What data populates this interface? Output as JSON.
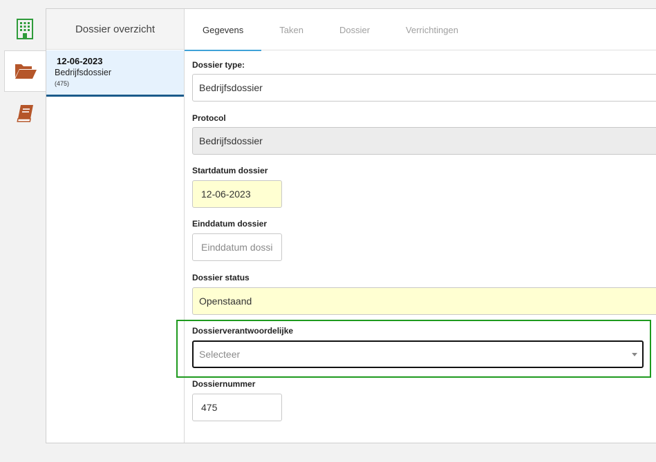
{
  "sidebar": {
    "items": [
      {
        "name": "building-icon",
        "color": "#2e9b3a"
      },
      {
        "name": "open-folder-icon",
        "color": "#b5562a"
      },
      {
        "name": "book-icon",
        "color": "#b5562a"
      }
    ]
  },
  "dossier_list": {
    "header": "Dossier overzicht",
    "entries": [
      {
        "date": "12-06-2023",
        "type": "Bedrijfsdossier",
        "id": "(475)"
      }
    ]
  },
  "tabs": [
    {
      "label": "Gegevens",
      "active": true
    },
    {
      "label": "Taken",
      "active": false
    },
    {
      "label": "Dossier",
      "active": false
    },
    {
      "label": "Verrichtingen",
      "active": false
    }
  ],
  "form": {
    "dossier_type": {
      "label": "Dossier type:",
      "value": "Bedrijfsdossier"
    },
    "protocol": {
      "label": "Protocol",
      "value": "Bedrijfsdossier"
    },
    "startdatum": {
      "label": "Startdatum dossier",
      "value": "12-06-2023"
    },
    "einddatum": {
      "label": "Einddatum dossier",
      "placeholder": "Einddatum dossi"
    },
    "status": {
      "label": "Dossier status",
      "value": "Openstaand"
    },
    "verantwoordelijke": {
      "label": "Dossierverantwoordelijke",
      "placeholder": "Selecteer"
    },
    "dossiernummer": {
      "label": "Dossiernummer",
      "value": "475"
    }
  },
  "colors": {
    "accent_tab": "#3fa2d8",
    "selected_entry_border": "#1a5a8a",
    "highlight": "#1e9a1e",
    "required_field": "#ffffd2"
  }
}
